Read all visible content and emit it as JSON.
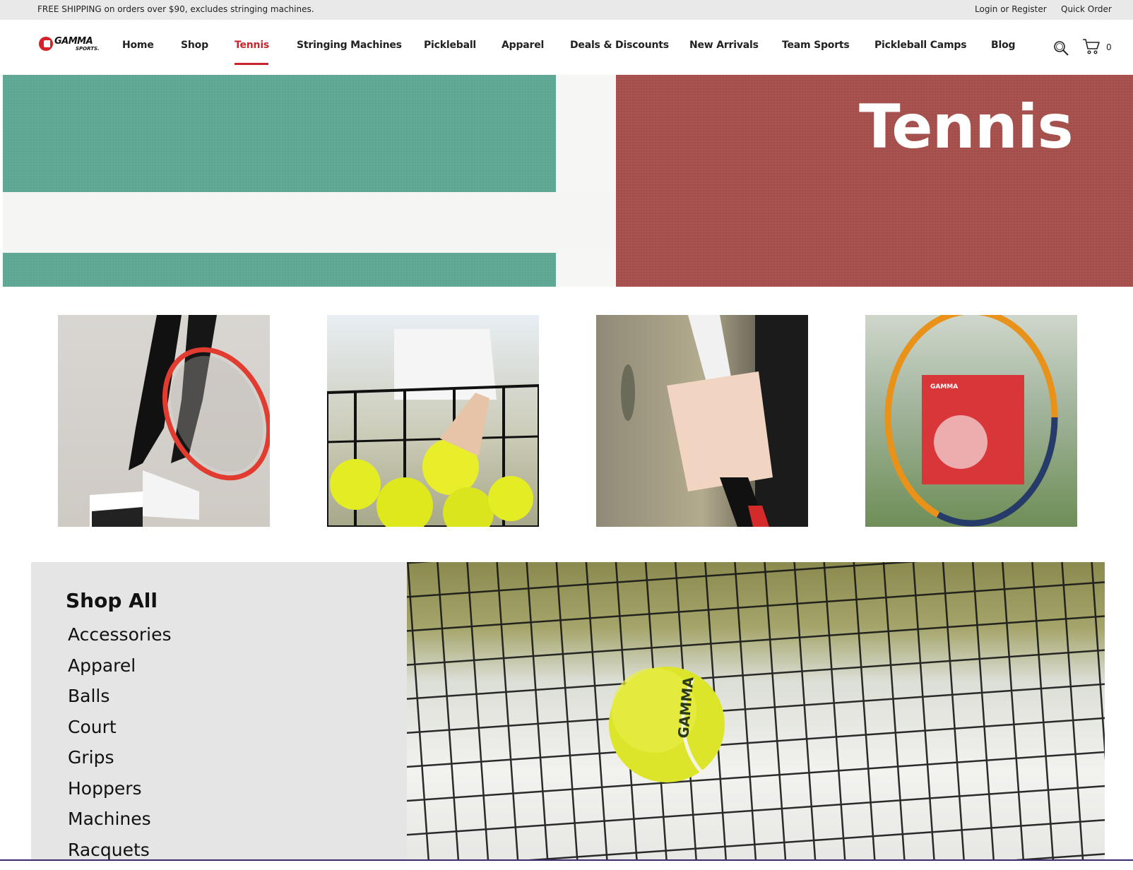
{
  "announcement": {
    "message": "FREE SHIPPING on orders over $90, excludes stringing machines.",
    "login": "Login",
    "or_register": "or Register",
    "quick_order": "Quick Order"
  },
  "brand": {
    "name": "GAMMA",
    "sub": "SPORTS.",
    "accent_color": "#c8252c"
  },
  "nav": {
    "items": [
      {
        "label": "Home"
      },
      {
        "label": "Shop"
      },
      {
        "label": "Tennis",
        "active": true
      },
      {
        "label": "Stringing Machines"
      },
      {
        "label": "Pickleball"
      },
      {
        "label": "Apparel"
      },
      {
        "label": "Deals & Discounts"
      },
      {
        "label": "New Arrivals"
      },
      {
        "label": "Team Sports"
      },
      {
        "label": "Pickleball Camps"
      },
      {
        "label": "Blog"
      }
    ],
    "cart_count": "0",
    "search_icon": "search-icon",
    "cart_icon": "cart-icon"
  },
  "hero": {
    "title": "Tennis"
  },
  "tiles": [
    {
      "icon": "racquet-player-photo"
    },
    {
      "icon": "ball-hopper-photo"
    },
    {
      "icon": "racquet-grip-photo"
    },
    {
      "icon": "string-pack-photo"
    }
  ],
  "shop": {
    "title": "Shop All",
    "items": [
      "Accessories",
      "Apparel",
      "Balls",
      "Court",
      "Grips",
      "Hoppers",
      "Machines",
      "Racquets"
    ]
  },
  "ball_brand": "GAMMA"
}
